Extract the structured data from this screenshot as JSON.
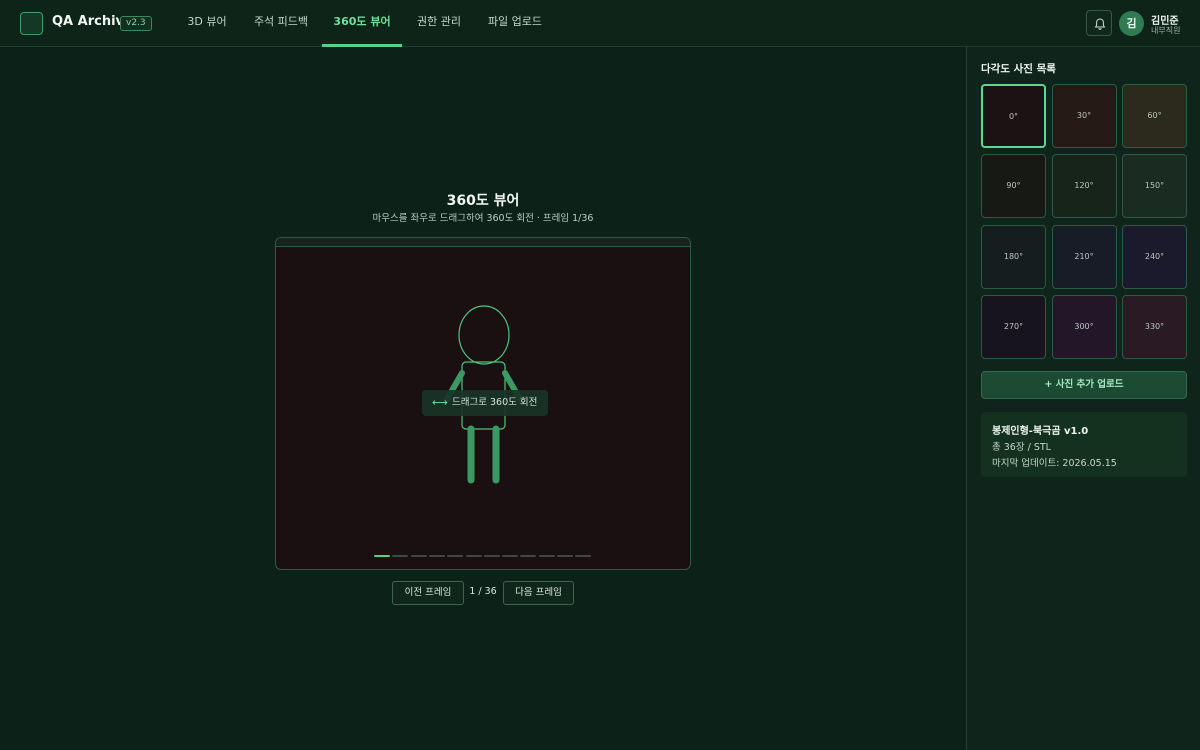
{
  "app": {
    "title": "QA Archive",
    "version": "v2.3"
  },
  "nav": {
    "tabs": [
      {
        "label": "3D 뷰어"
      },
      {
        "label": "주석 피드백"
      },
      {
        "label": "360도 뷰어"
      },
      {
        "label": "권한 관리"
      },
      {
        "label": "파일 업로드"
      }
    ],
    "active_index": 2
  },
  "user": {
    "initial": "김",
    "name": "김민준",
    "role": "내부직원"
  },
  "icons": {
    "notification": "bell-icon",
    "logo": "square-logo-icon",
    "drag": "horizontal-arrows-icon"
  },
  "viewer": {
    "title": "360도 뷰어",
    "subtitle": "마우스를 좌우로 드래그하여 360도 회전 · 프레임 1/36",
    "drag_hint_symbol": "⟷",
    "drag_hint": "드래그로 360도 회전",
    "progress": {
      "segments": 12,
      "current": 1
    },
    "prev_label": "이전 프레임",
    "next_label": "다음 프레임",
    "frame_counter": "1 / 36"
  },
  "sidebar": {
    "title": "다각도 사진 목록",
    "thumbnails": [
      {
        "label": "0°",
        "color": "#1c1214",
        "selected": true
      },
      {
        "label": "30°",
        "color": "#261a17",
        "selected": false
      },
      {
        "label": "60°",
        "color": "#2c2a1c",
        "selected": false
      },
      {
        "label": "90°",
        "color": "#171a14",
        "selected": false
      },
      {
        "label": "120°",
        "color": "#16241a",
        "selected": false
      },
      {
        "label": "150°",
        "color": "#1a2b22",
        "selected": false
      },
      {
        "label": "180°",
        "color": "#141e1e",
        "selected": false
      },
      {
        "label": "210°",
        "color": "#171c26",
        "selected": false
      },
      {
        "label": "240°",
        "color": "#1a1a2c",
        "selected": false
      },
      {
        "label": "270°",
        "color": "#17141e",
        "selected": false
      },
      {
        "label": "300°",
        "color": "#221628",
        "selected": false
      },
      {
        "label": "330°",
        "color": "#2a1a24",
        "selected": false
      }
    ],
    "upload_label": "+ 사진 추가 업로드",
    "info": {
      "name": "봉제인형-북극곰 v1.0",
      "count": "총 36장 / STL",
      "date": "마지막 업데이트: 2026.05.15"
    }
  },
  "colors": {
    "accent": "#55d089",
    "background": "#0c2118",
    "viewer_bg": "#1a1012"
  }
}
